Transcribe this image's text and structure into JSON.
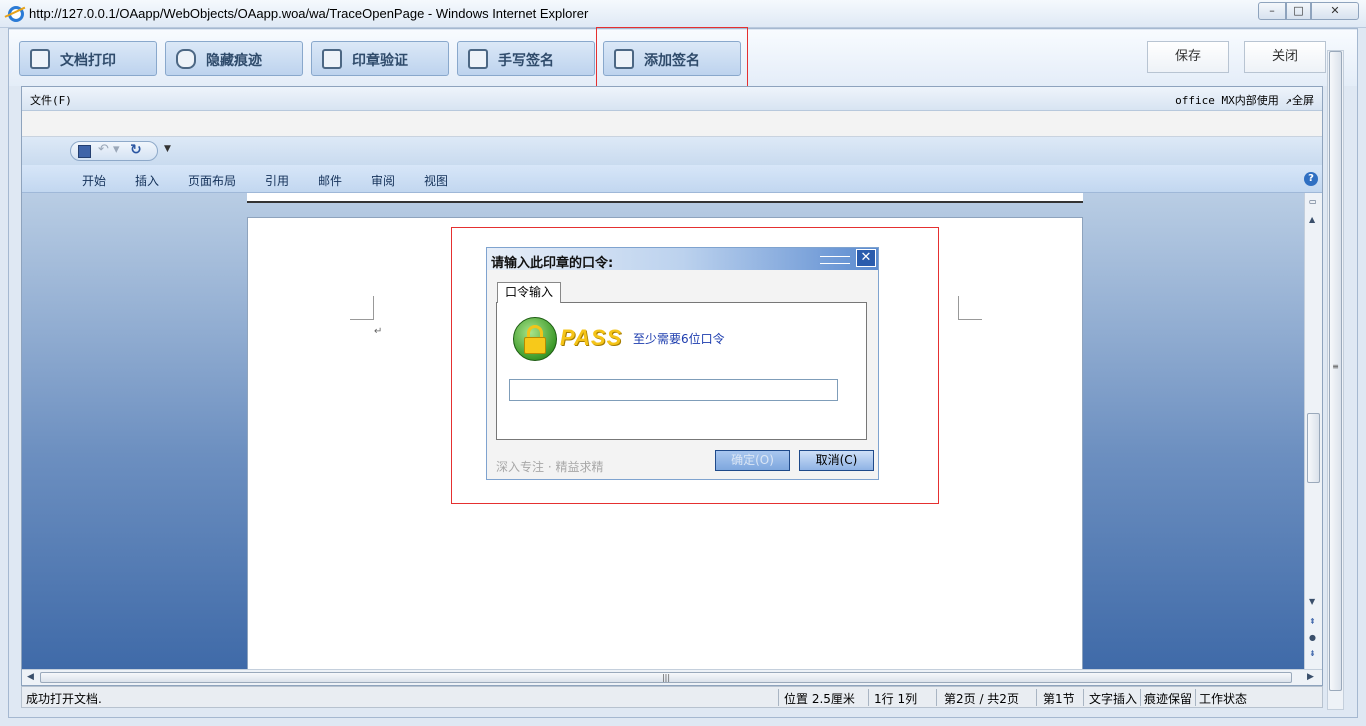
{
  "window": {
    "title": "http://127.0.0.1/OAapp/WebObjects/OAapp.woa/wa/TraceOpenPage - Windows Internet Explorer",
    "controls": {
      "minimize": "–",
      "maximize": "□",
      "close": "✕"
    }
  },
  "toolbar": {
    "buttons": [
      {
        "label": "文档打印",
        "icon": "printer-icon"
      },
      {
        "label": "隐藏痕迹",
        "icon": "mask-icon"
      },
      {
        "label": "印章验证",
        "icon": "seal-icon"
      },
      {
        "label": "手写签名",
        "icon": "pen-sign-icon"
      },
      {
        "label": "添加签名",
        "icon": "add-signature-icon"
      }
    ],
    "save_label": "保存",
    "close_label": "关闭"
  },
  "office": {
    "menu_file": "文件(F)",
    "menu_right": "office MX内部使用 ↗全屏",
    "ribbon_tabs": [
      "开始",
      "插入",
      "页面布局",
      "引用",
      "邮件",
      "审阅",
      "视图"
    ],
    "paragraph_mark": "↵",
    "help_icon": "?"
  },
  "dialog": {
    "title": "请输入此印章的口令:",
    "tab": "口令输入",
    "pass_logo": "PASS",
    "hint": "至少需要6位口令",
    "password_value": "",
    "motto": "深入专注 · 精益求精",
    "ok_label": "确定(O)",
    "cancel_label": "取消(C)",
    "close_glyph": "✕"
  },
  "statusbar": {
    "message": "成功打开文档.",
    "position": "位置 2.5厘米",
    "row_col": "1行 1列",
    "page": "第2页 / 共2页",
    "section": "第1节",
    "mode": "文字插入",
    "track": "痕迹保留",
    "state": "工作状态"
  },
  "accent": {
    "highlight": "#e53030",
    "dialog_title": "#5b8bd0"
  }
}
